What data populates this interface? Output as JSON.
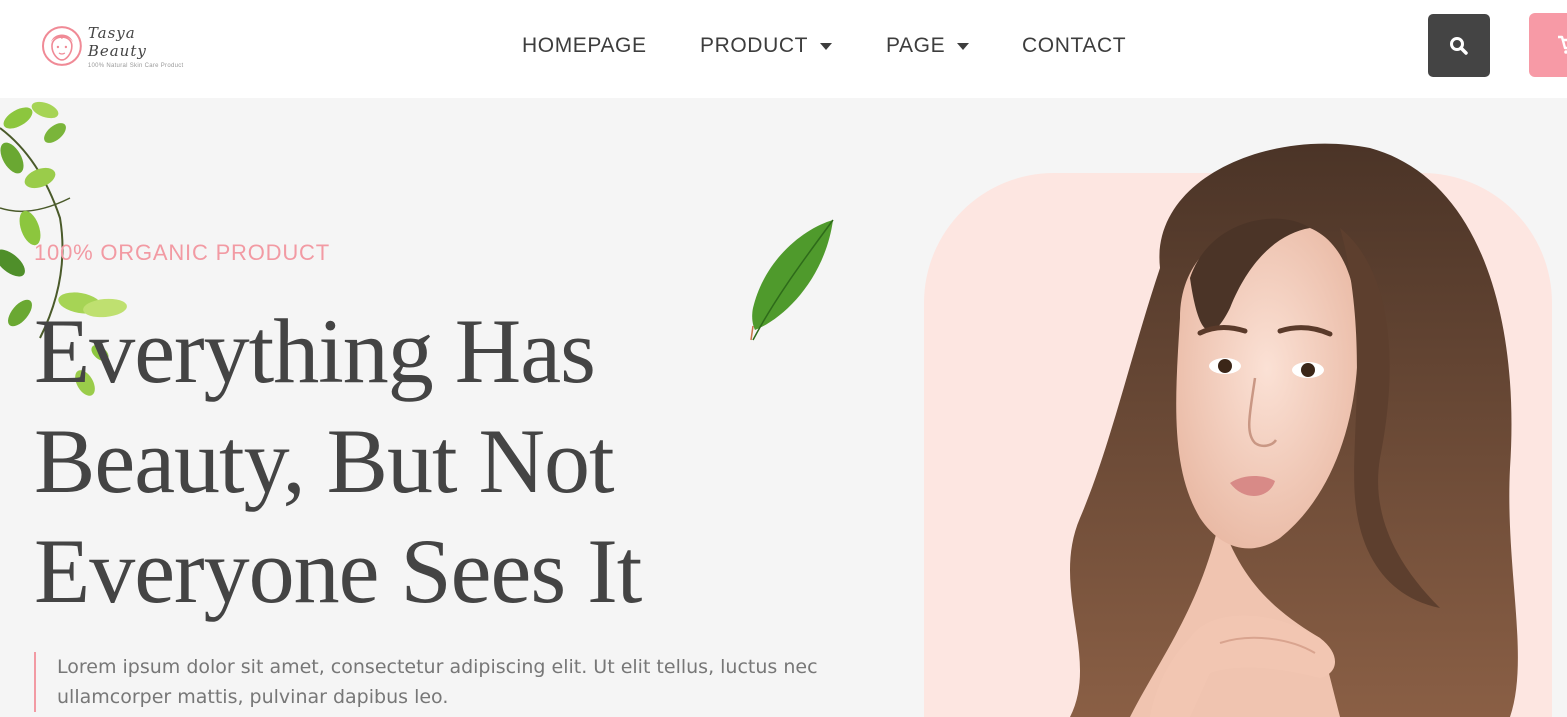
{
  "brand": {
    "name": "Tasya Beauty",
    "tagline": "100% Natural Skin Care Product"
  },
  "nav": {
    "items": [
      {
        "label": "HOMEPAGE",
        "has_dropdown": false
      },
      {
        "label": "PRODUCT",
        "has_dropdown": true
      },
      {
        "label": "PAGE",
        "has_dropdown": true
      },
      {
        "label": "CONTACT",
        "has_dropdown": false
      }
    ]
  },
  "header": {
    "search_icon": "search-icon",
    "cart_icon": "cart-icon"
  },
  "hero": {
    "eyebrow": "100% ORGANIC PRODUCT",
    "headline": [
      "Everything Has",
      "Beauty, But Not",
      "Everyone Sees It"
    ],
    "description": "Lorem ipsum dolor sit amet, consectetur adipiscing elit. Ut elit tellus, luctus nec ullamcorper mattis, pulvinar dapibus leo."
  },
  "colors": {
    "accent_pink": "#f29aa3",
    "dark_button": "#444444",
    "panel_pink": "#fde6e1",
    "hero_bg": "#f5f5f5",
    "text_dark": "#444444"
  }
}
